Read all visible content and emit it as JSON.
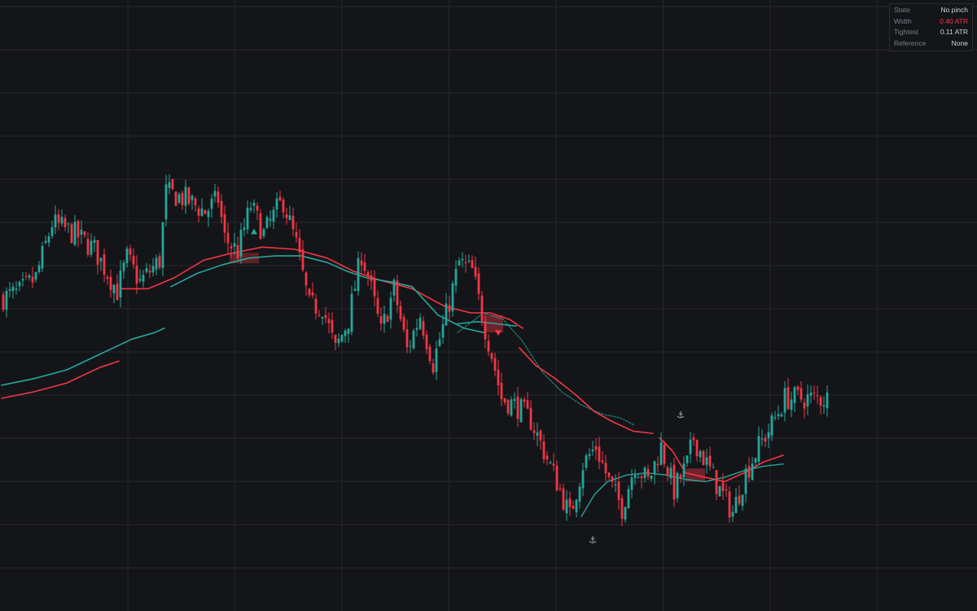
{
  "colors": {
    "background": "#141519",
    "grid": "#23262d",
    "up": "#26a69a",
    "down": "#f23645",
    "panel_label": "#7b7f88",
    "panel_value": "#d1d4dc",
    "panel_alert": "#f23645"
  },
  "info_panel": {
    "rows": [
      {
        "label": "State",
        "value": "No pinch",
        "color": "default"
      },
      {
        "label": "Width",
        "value": "0.40 ATR",
        "color": "alert"
      },
      {
        "label": "Tightest",
        "value": "0.11 ATR",
        "color": "default"
      },
      {
        "label": "Reference",
        "value": "None",
        "color": "default"
      }
    ]
  },
  "chart_data": {
    "type": "candlestick",
    "x_axis": {
      "type": "bar-index",
      "range": [
        0,
        255
      ],
      "labels_shown": false
    },
    "y_axis": {
      "type": "price",
      "range": [
        0,
        100
      ],
      "unit": "relative price scale (no tick labels shown)",
      "labels_shown": false
    },
    "grid": true,
    "candles": {
      "count": 254,
      "up_color": "#26a69a",
      "down_color": "#f23645",
      "anchors": [
        {
          "i": 0,
          "c": 60.0
        },
        {
          "i": 5,
          "c": 61.2
        },
        {
          "i": 10,
          "c": 64.5
        },
        {
          "i": 15,
          "c": 77.0
        },
        {
          "i": 22,
          "c": 74.5
        },
        {
          "i": 28,
          "c": 71.0
        },
        {
          "i": 35,
          "c": 61.5
        },
        {
          "i": 38,
          "c": 69.0
        },
        {
          "i": 42,
          "c": 63.5
        },
        {
          "i": 48,
          "c": 68.5
        },
        {
          "i": 50,
          "c": 84.0
        },
        {
          "i": 56,
          "c": 82.5
        },
        {
          "i": 62,
          "c": 79.5
        },
        {
          "i": 66,
          "c": 82.5
        },
        {
          "i": 68,
          "c": 73.5
        },
        {
          "i": 72,
          "c": 70.5
        },
        {
          "i": 76,
          "c": 81.0
        },
        {
          "i": 80,
          "c": 74.5
        },
        {
          "i": 84,
          "c": 80.0
        },
        {
          "i": 86,
          "c": 82.0
        },
        {
          "i": 90,
          "c": 72.0
        },
        {
          "i": 94,
          "c": 58.0
        },
        {
          "i": 98,
          "c": 58.0
        },
        {
          "i": 102,
          "c": 48.0
        },
        {
          "i": 106,
          "c": 55.0
        },
        {
          "i": 110,
          "c": 70.0
        },
        {
          "i": 112,
          "c": 65.0
        },
        {
          "i": 116,
          "c": 52.0
        },
        {
          "i": 120,
          "c": 62.0
        },
        {
          "i": 124,
          "c": 48.0
        },
        {
          "i": 128,
          "c": 56.0
        },
        {
          "i": 132,
          "c": 45.0
        },
        {
          "i": 136,
          "c": 56.0
        },
        {
          "i": 140,
          "c": 68.0
        },
        {
          "i": 144,
          "c": 66.0
        },
        {
          "i": 148,
          "c": 53.0
        },
        {
          "i": 150,
          "c": 47.0
        },
        {
          "i": 153,
          "c": 37.0
        },
        {
          "i": 158,
          "c": 35.0
        },
        {
          "i": 162,
          "c": 32.0
        },
        {
          "i": 166,
          "c": 25.0
        },
        {
          "i": 170,
          "c": 18.0
        },
        {
          "i": 174,
          "c": 10.0
        },
        {
          "i": 178,
          "c": 22.0
        },
        {
          "i": 182,
          "c": 26.0
        },
        {
          "i": 186,
          "c": 18.0
        },
        {
          "i": 190,
          "c": 12.0
        },
        {
          "i": 194,
          "c": 22.0
        },
        {
          "i": 198,
          "c": 18.0
        },
        {
          "i": 202,
          "c": 26.0
        },
        {
          "i": 206,
          "c": 16.0
        },
        {
          "i": 210,
          "c": 22.0
        },
        {
          "i": 212,
          "c": 28.0
        },
        {
          "i": 216,
          "c": 22.0
        },
        {
          "i": 220,
          "c": 16.0
        },
        {
          "i": 224,
          "c": 11.0
        },
        {
          "i": 228,
          "c": 20.0
        },
        {
          "i": 232,
          "c": 26.0
        },
        {
          "i": 236,
          "c": 31.0
        },
        {
          "i": 240,
          "c": 37.0
        }
      ],
      "noise_amplitude": 2.8,
      "wick_amplitude": 2.4
    },
    "series": [
      {
        "color": "#26a69a",
        "width": 1.6,
        "points": [
          [
            0,
            40
          ],
          [
            10,
            41.5
          ],
          [
            20,
            43.5
          ],
          [
            30,
            47.0
          ],
          [
            40,
            50.5
          ],
          [
            47,
            52.0
          ],
          [
            50,
            53.0
          ]
        ]
      },
      {
        "color": "#f23645",
        "width": 1.6,
        "points": [
          [
            0,
            37
          ],
          [
            10,
            38.5
          ],
          [
            20,
            40.5
          ],
          [
            30,
            44.0
          ],
          [
            36,
            45.5
          ]
        ]
      },
      {
        "color": "#f23645",
        "width": 1.6,
        "points": [
          [
            37,
            62.0
          ],
          [
            45,
            62.0
          ],
          [
            53,
            64.5
          ],
          [
            62,
            68.5
          ],
          [
            70,
            70.0
          ],
          [
            80,
            71.5
          ],
          [
            90,
            71.0
          ],
          [
            100,
            69.0
          ],
          [
            108,
            66.0
          ],
          [
            116,
            64.0
          ],
          [
            126,
            62.0
          ],
          [
            136,
            58.0
          ],
          [
            144,
            56.5
          ],
          [
            150,
            56.5
          ],
          [
            156,
            55.0
          ],
          [
            160,
            53.0
          ]
        ]
      },
      {
        "color": "#26a69a",
        "width": 1.6,
        "points": [
          [
            52,
            62.5
          ],
          [
            60,
            65.5
          ],
          [
            68,
            67.5
          ],
          [
            76,
            69.0
          ],
          [
            84,
            69.5
          ],
          [
            92,
            69.5
          ],
          [
            100,
            68.0
          ],
          [
            106,
            66.0
          ],
          [
            112,
            64.5
          ],
          [
            120,
            63.5
          ],
          [
            126,
            62.5
          ],
          [
            134,
            56.0
          ],
          [
            142,
            53.0
          ],
          [
            148,
            52.0
          ]
        ]
      },
      {
        "color": "#26a69a",
        "width": 1.6,
        "points": [
          [
            140,
            54.0
          ],
          [
            146,
            54.5
          ],
          [
            152,
            54.0
          ],
          [
            158,
            53.5
          ]
        ]
      },
      {
        "color": "#26a69a",
        "width": 1.4,
        "points": [
          [
            140,
            52.0
          ],
          [
            148,
            56.5
          ],
          [
            154,
            55.0
          ],
          [
            160,
            50.0
          ],
          [
            166,
            43.0
          ],
          [
            172,
            38.5
          ],
          [
            178,
            35.5
          ],
          [
            184,
            33.5
          ],
          [
            190,
            32.5
          ],
          [
            194,
            31.0
          ]
        ],
        "dash": "2 2"
      },
      {
        "color": "#f23645",
        "width": 1.6,
        "points": [
          [
            159,
            48.5
          ],
          [
            164,
            44.5
          ],
          [
            170,
            41.5
          ],
          [
            176,
            38.0
          ],
          [
            182,
            34.0
          ],
          [
            188,
            31.5
          ],
          [
            194,
            29.5
          ],
          [
            200,
            29.0
          ]
        ]
      },
      {
        "color": "#f23645",
        "width": 1.6,
        "points": [
          [
            202,
            28.0
          ],
          [
            206,
            25.0
          ],
          [
            210,
            20.0
          ],
          [
            216,
            19.0
          ],
          [
            222,
            18.0
          ],
          [
            228,
            20.0
          ],
          [
            234,
            22.5
          ],
          [
            240,
            24.0
          ]
        ]
      },
      {
        "color": "#26a69a",
        "width": 1.4,
        "points": [
          [
            178,
            10.0
          ],
          [
            182,
            15.0
          ],
          [
            186,
            18.0
          ],
          [
            192,
            19.5
          ],
          [
            198,
            20.0
          ],
          [
            204,
            19.5
          ],
          [
            210,
            18.5
          ],
          [
            216,
            18.0
          ],
          [
            222,
            19.0
          ],
          [
            228,
            20.5
          ],
          [
            234,
            21.5
          ],
          [
            240,
            22.0
          ]
        ]
      }
    ],
    "markers": [
      {
        "type": "triangle-up",
        "color": "#26a69a",
        "i": 77,
        "y": 75.0
      },
      {
        "type": "triangle-down",
        "color": "#f23645",
        "i": 152,
        "y": 52.0
      },
      {
        "type": "anchor",
        "color": "#b2b5be",
        "i": 181,
        "y": 4.0
      },
      {
        "type": "anchor",
        "color": "#b2b5be",
        "i": 208,
        "y": 32.5
      }
    ],
    "zones": [
      {
        "i0": 70,
        "i1": 79,
        "y0": 67.8,
        "y1": 70.2,
        "color": "#f23645",
        "opacity": 0.35
      },
      {
        "i0": 148,
        "i1": 154,
        "y0": 52.0,
        "y1": 56.0,
        "color": "#f23645",
        "opacity": 0.4
      },
      {
        "i0": 210,
        "i1": 216,
        "y0": 18.0,
        "y1": 21.0,
        "color": "#f23645",
        "opacity": 0.4
      }
    ]
  }
}
